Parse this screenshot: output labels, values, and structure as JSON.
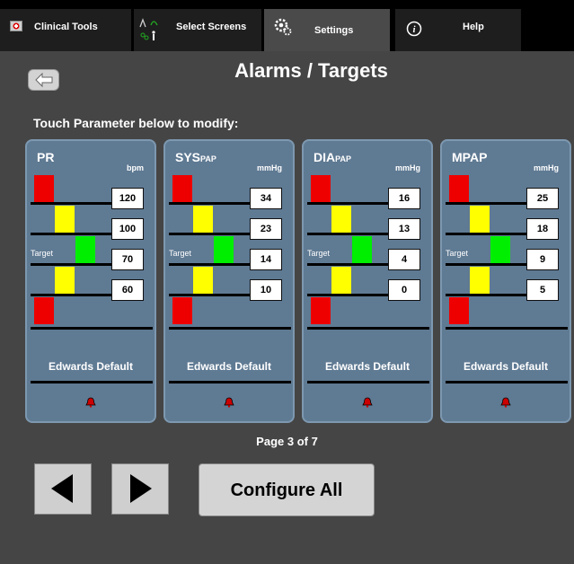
{
  "tabs": {
    "clinical_tools": "Clinical Tools",
    "select_screens": "Select Screens",
    "settings": "Settings",
    "help": "Help"
  },
  "header": {
    "title": "Alarms / Targets",
    "instruction": "Touch Parameter below to modify:"
  },
  "parameters": [
    {
      "name": "PR",
      "subscript": "",
      "unit": "bpm",
      "values": [
        "120",
        "100",
        "70",
        "60"
      ],
      "target_label": "Target",
      "default_label": "Edwards Default"
    },
    {
      "name": "SYS",
      "subscript": "PAP",
      "unit": "mmHg",
      "values": [
        "34",
        "23",
        "14",
        "10"
      ],
      "target_label": "Target",
      "default_label": "Edwards Default"
    },
    {
      "name": "DIA",
      "subscript": "PAP",
      "unit": "mmHg",
      "values": [
        "16",
        "13",
        "4",
        "0"
      ],
      "target_label": "Target",
      "default_label": "Edwards Default"
    },
    {
      "name": "MPAP",
      "subscript": "",
      "unit": "mmHg",
      "values": [
        "25",
        "18",
        "9",
        "5"
      ],
      "target_label": "Target",
      "default_label": "Edwards Default"
    }
  ],
  "footer": {
    "page_indicator": "Page 3 of 7",
    "configure_label": "Configure All"
  },
  "colors": {
    "background": "#454545",
    "card": "#5f7a93",
    "alarm_red": "#ee0000",
    "warning_yellow": "#ffff00",
    "target_green": "#00ee00",
    "bell": "#cc0000"
  },
  "icons": {
    "clinical_tools": "first-aid-icon",
    "select_screens": "screens-icon",
    "settings": "gear-icon",
    "help": "info-icon",
    "back": "back-arrow-icon",
    "alarm": "bell-icon",
    "prev": "triangle-left-icon",
    "next": "triangle-right-icon"
  }
}
